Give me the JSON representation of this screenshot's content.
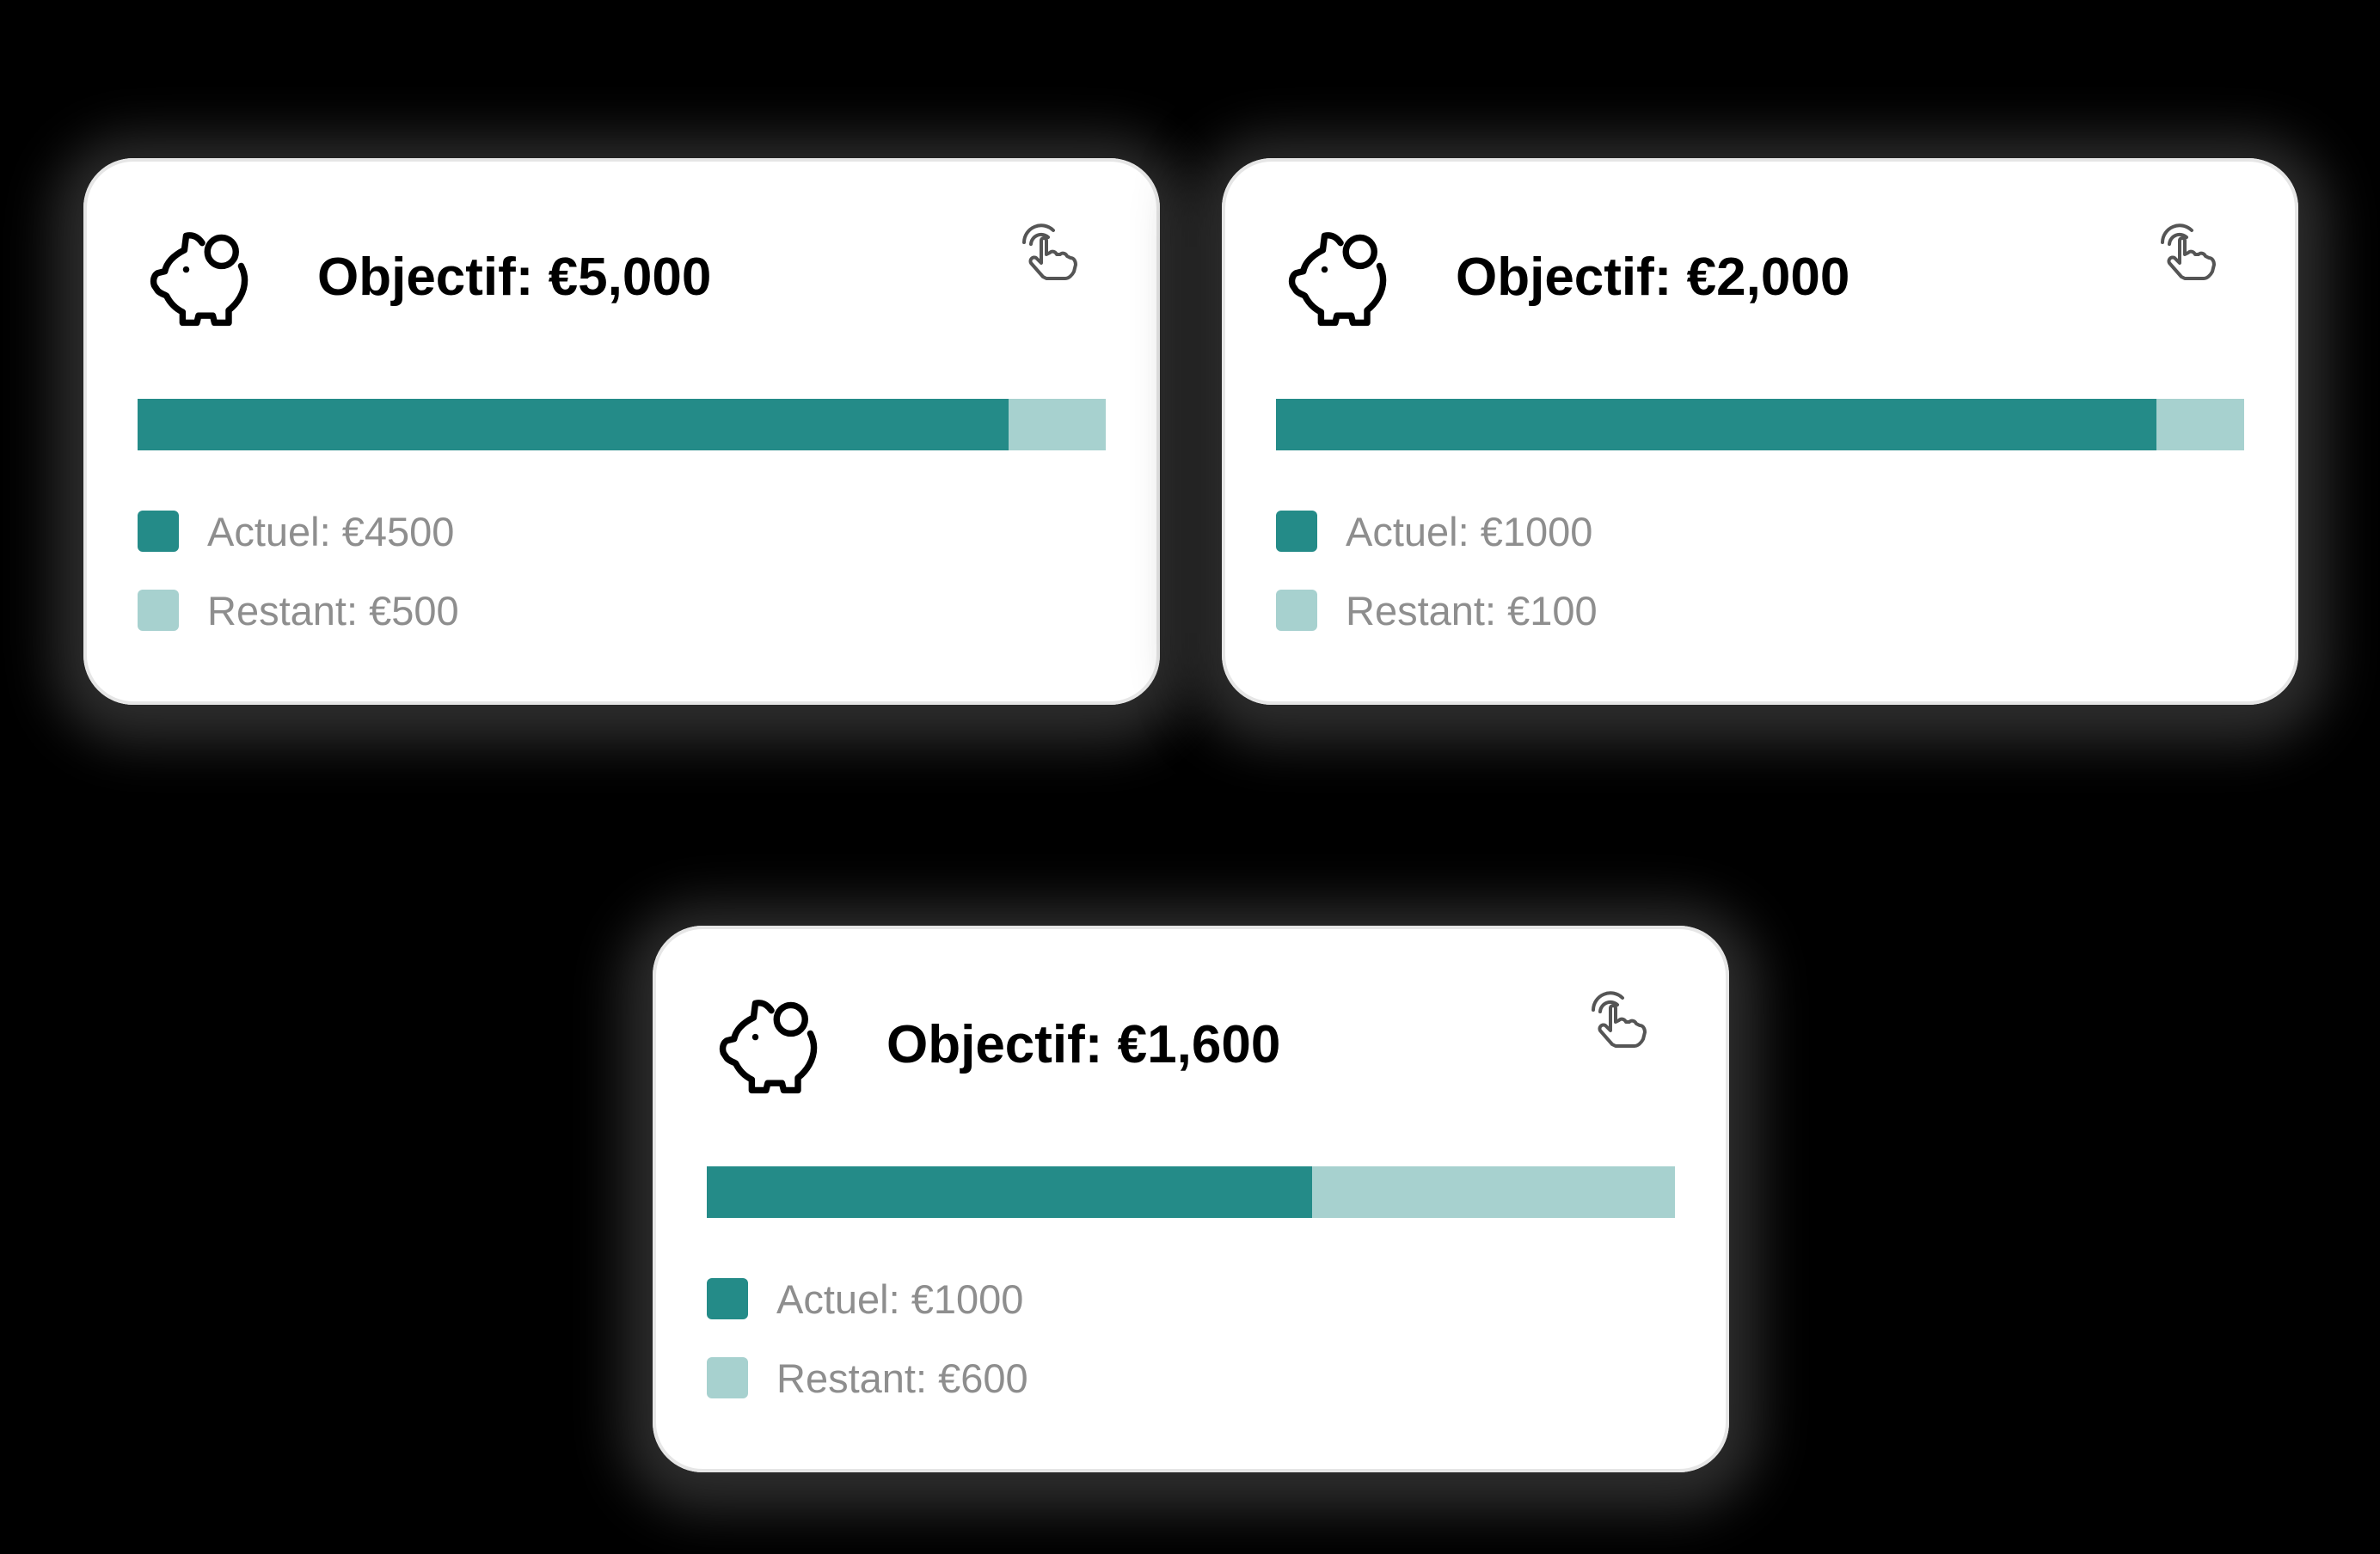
{
  "colors": {
    "current": "#248b88",
    "remaining": "#a7d1cf",
    "card_background": "#ffffff"
  },
  "icons": {
    "goal": "piggy-bank-icon",
    "action": "tap-gesture-icon"
  },
  "goals": [
    {
      "title": "Objectif: €5,000",
      "target": 5000,
      "current": 4500,
      "remaining_value": 500,
      "current_label": "Actuel: €4500",
      "remaining_label": "Restant: €500"
    },
    {
      "title": "Objectif: €2,000",
      "target": 2000,
      "current": 1000,
      "remaining_value": 100,
      "current_label": "Actuel: €1000",
      "remaining_label": "Restant: €100"
    },
    {
      "title": "Objectif: €1,600",
      "target": 1600,
      "current": 1000,
      "remaining_value": 600,
      "current_label": "Actuel: €1000",
      "remaining_label": "Restant: €600"
    }
  ]
}
